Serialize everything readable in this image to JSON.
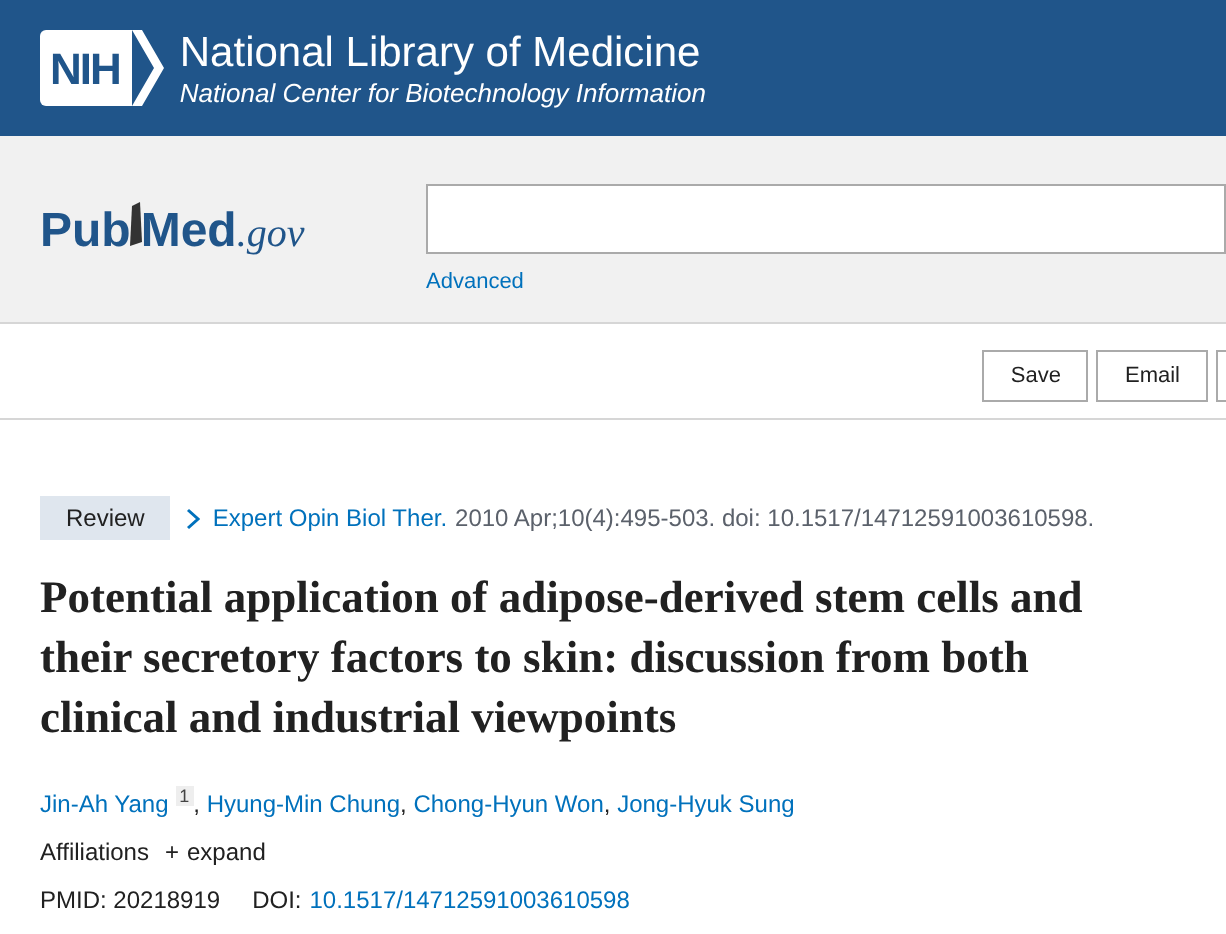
{
  "header": {
    "logo_text": "NIH",
    "title": "National Library of Medicine",
    "subtitle": "National Center for Biotechnology Information"
  },
  "search": {
    "logo": {
      "first": "Pub",
      "second": "Med",
      "suffix": ".gov"
    },
    "advanced_link": "Advanced"
  },
  "toolbar": {
    "buttons": [
      "Save",
      "Email"
    ]
  },
  "article": {
    "type_badge": "Review",
    "journal": "Expert Opin Biol Ther.",
    "citation": "2010 Apr;10(4):495-503. doi: 10.1517/14712591003610598.",
    "title": "Potential application of adipose-derived stem cells and their secretory factors to skin: discussion from both clinical and industrial viewpoints",
    "authors": [
      {
        "name": "Jin-Ah Yang",
        "affiliation": "1",
        "separator": ","
      },
      {
        "name": "Hyung-Min Chung",
        "separator": ","
      },
      {
        "name": "Chong-Hyun Won",
        "separator": ","
      },
      {
        "name": "Jong-Hyuk Sung"
      }
    ],
    "affiliations_label": "Affiliations",
    "expand": {
      "icon": "+",
      "label": "expand",
      "expanded": false
    },
    "pmid_label": "PMID:",
    "pmid": "20218919",
    "doi_label": "DOI:",
    "doi": "10.1517/14712591003610598"
  }
}
